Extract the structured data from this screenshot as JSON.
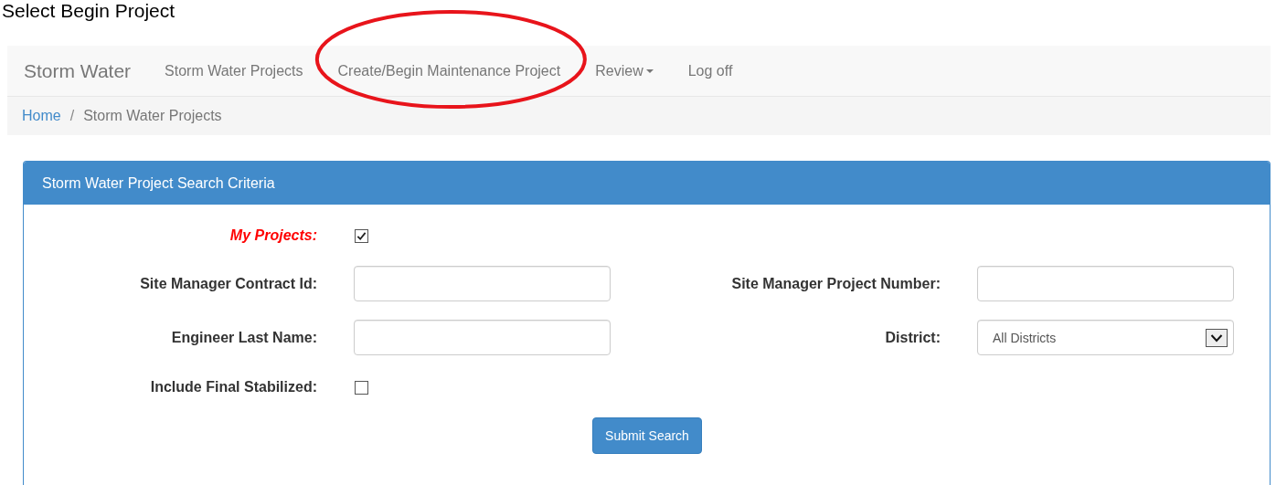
{
  "page_title": "Select Begin Project",
  "navbar": {
    "brand": "Storm Water",
    "items": [
      {
        "label": "Storm Water Projects",
        "kind": "link",
        "highlighted": false
      },
      {
        "label": "Create/Begin Maintenance Project",
        "kind": "link",
        "highlighted": true
      },
      {
        "label": "Review",
        "kind": "dropdown",
        "highlighted": false
      },
      {
        "label": "Log off",
        "kind": "link",
        "highlighted": false
      }
    ]
  },
  "breadcrumb": {
    "separator": "/",
    "items": [
      {
        "label": "Home",
        "kind": "link"
      },
      {
        "label": "Storm Water Projects",
        "kind": "current"
      }
    ]
  },
  "panel": {
    "title": "Storm Water Project Search Criteria",
    "rows": [
      [
        {
          "label": "My Projects:",
          "kind": "checkbox",
          "checked": true,
          "emphasized": true
        }
      ],
      [
        {
          "label": "Site Manager Contract Id:",
          "kind": "text",
          "emphasized": false
        },
        {
          "label": "Site Manager Project Number:",
          "kind": "text",
          "emphasized": false
        }
      ],
      [
        {
          "label": "Engineer Last Name:",
          "kind": "text",
          "emphasized": false
        },
        {
          "label": "District:",
          "kind": "select",
          "value": "All Districts",
          "emphasized": false
        }
      ],
      [
        {
          "label": "Include Final Stabilized:",
          "kind": "checkbox",
          "checked": false,
          "emphasized": false
        }
      ]
    ],
    "submit": "Submit Search"
  }
}
